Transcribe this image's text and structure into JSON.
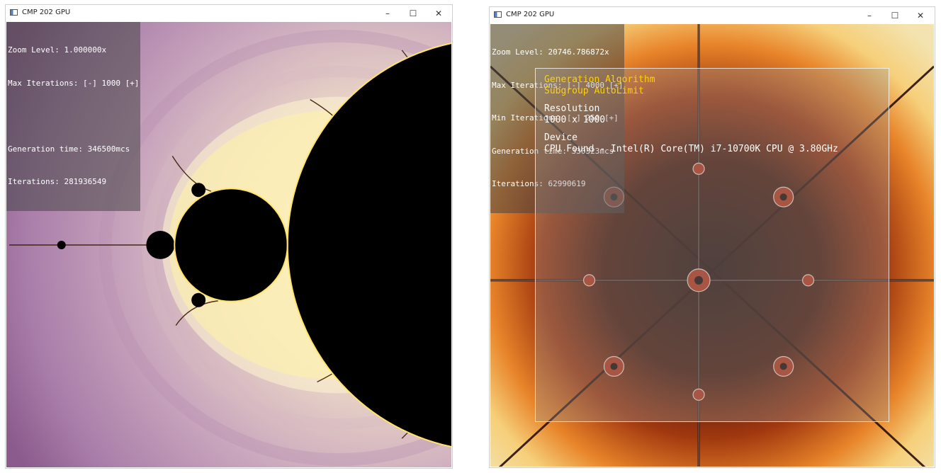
{
  "left_window": {
    "title": "CMP 202 GPU",
    "controls": {
      "minimize": "–",
      "maximize": "☐",
      "close": "✕"
    },
    "hud": {
      "zoom_level": "Zoom Level: 1.000000x",
      "max_iterations": "Max Iterations: [-] 1000 [+]",
      "generation_time": "Generation time: 346500mcs",
      "iterations": "Iterations: 281936549"
    },
    "colors": {
      "background": "#9c6f9c",
      "set": "#000000",
      "edge": "#ffe36a"
    }
  },
  "right_window": {
    "title": "CMP 202 GPU",
    "controls": {
      "minimize": "–",
      "maximize": "☐",
      "close": "✕"
    },
    "hud": {
      "zoom_level": "Zoom Level: 20746.786872x",
      "max_iterations": "Max Iterations: [-] 4000 [+]",
      "min_iterations": "Min Iterations: [-] 250 [+]",
      "generation_time": "Generation time: 330323mcs",
      "iterations": "Iterations: 62990619"
    },
    "info_panel": {
      "algorithm_heading": "Generation Algorithm",
      "algorithm_value": "Subgroup AutoLimit",
      "resolution_heading": "Resolution",
      "resolution_value": "1000 x 1000",
      "device_heading": "Device",
      "device_value": "CPU Found - Intel(R) Core(TM) i7-10700K CPU @ 3.80GHz"
    },
    "colors": {
      "outer": "#f3d98a",
      "mid": "#c8501a",
      "inner": "#2a1410",
      "accent": "#ffd200"
    }
  }
}
